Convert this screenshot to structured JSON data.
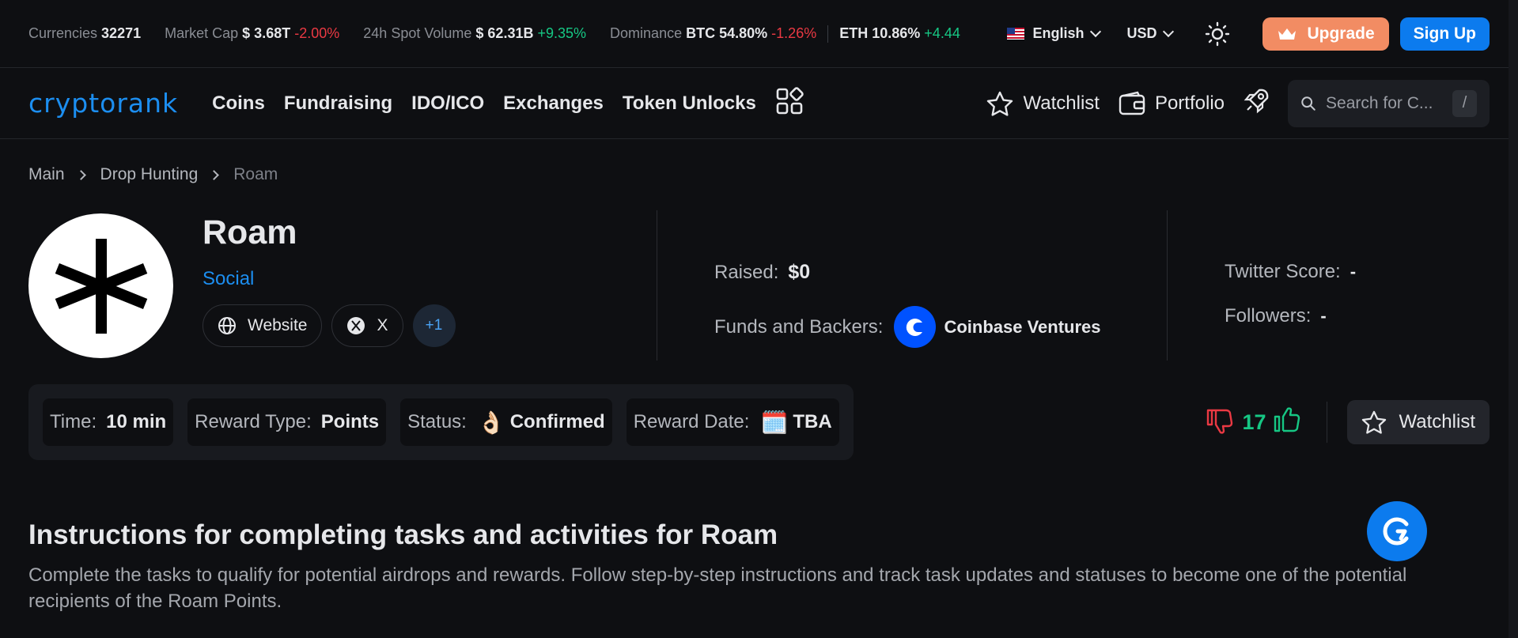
{
  "topbar": {
    "currencies_label": "Currencies",
    "currencies_value": "32271",
    "marketcap_label": "Market Cap",
    "marketcap_value": "$ 3.68T",
    "marketcap_change": "-2.00%",
    "volume_label": "24h Spot Volume",
    "volume_value": "$ 62.31B",
    "volume_change": "+9.35%",
    "dominance_label": "Dominance",
    "btc_dom": "BTC 54.80%",
    "btc_change": "-1.26%",
    "eth_dom": "ETH 10.86%",
    "eth_change": "+4.44",
    "language": "English",
    "currency": "USD",
    "upgrade_label": "Upgrade",
    "signup_label": "Sign Up"
  },
  "nav": {
    "logo": "cryptorank",
    "items": [
      "Coins",
      "Fundraising",
      "IDO/ICO",
      "Exchanges",
      "Token Unlocks"
    ],
    "watchlist_label": "Watchlist",
    "portfolio_label": "Portfolio",
    "search_placeholder": "Search for C...",
    "search_shortcut": "/"
  },
  "breadcrumb": [
    "Main",
    "Drop Hunting",
    "Roam"
  ],
  "project": {
    "name": "Roam",
    "category": "Social",
    "website_label": "Website",
    "x_label": "X",
    "more_links": "+1",
    "raised_label": "Raised:",
    "raised_value": "$0",
    "funds_label": "Funds and Backers:",
    "backer_name": "Coinbase Ventures",
    "twitter_label": "Twitter Score:",
    "twitter_value": "-",
    "followers_label": "Followers:",
    "followers_value": "-"
  },
  "meta": {
    "time_label": "Time:",
    "time_value": "10 min",
    "reward_type_label": "Reward Type:",
    "reward_type_value": "Points",
    "status_label": "Status:",
    "status_emoji": "👌🏻",
    "status_value": "Confirmed",
    "reward_date_label": "Reward Date:",
    "reward_date_emoji": "🗓️",
    "reward_date_value": "TBA",
    "votes": "17",
    "watchlist_label": "Watchlist"
  },
  "instructions": {
    "title": "Instructions for completing tasks and activities for Roam",
    "body": "Complete the tasks to qualify for potential airdrops and rewards. Follow step-by-step instructions and track task updates and statuses to become one of the potential recipients of the Roam Points."
  },
  "colors": {
    "accent": "#0c7bee",
    "upgrade": "#f28c63",
    "negative": "#ea3943",
    "positive": "#16c784"
  }
}
